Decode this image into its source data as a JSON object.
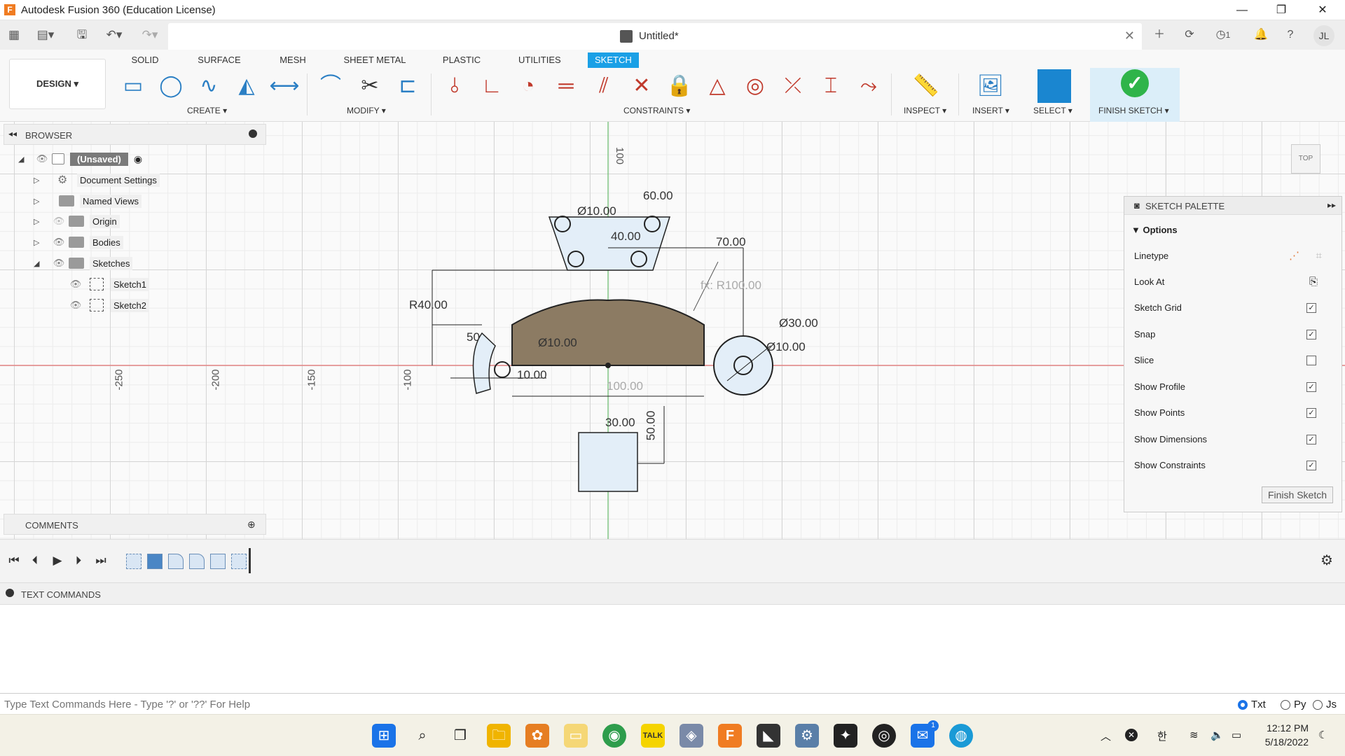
{
  "window": {
    "title": "Autodesk Fusion 360 (Education License)"
  },
  "document": {
    "name": "Untitled*",
    "notifications_count": "1",
    "user_initials": "JL"
  },
  "toolbar": {
    "tabs": [
      "SOLID",
      "SURFACE",
      "MESH",
      "SHEET METAL",
      "PLASTIC",
      "UTILITIES",
      "SKETCH"
    ],
    "active_tab": "SKETCH",
    "workspace": "DESIGN ▾",
    "groups": {
      "create": "CREATE ▾",
      "modify": "MODIFY ▾",
      "constraints": "CONSTRAINTS ▾",
      "inspect": "INSPECT ▾",
      "insert": "INSERT ▾",
      "select": "SELECT ▾",
      "finish_sketch": "FINISH SKETCH ▾"
    }
  },
  "browser": {
    "title": "BROWSER",
    "root": "(Unsaved)",
    "items": [
      "Document Settings",
      "Named Views",
      "Origin",
      "Bodies",
      "Sketches"
    ],
    "sketches": [
      "Sketch1",
      "Sketch2"
    ]
  },
  "comments": {
    "title": "COMMENTS"
  },
  "sketch": {
    "dimensions": {
      "d_top_left": "Ø10.00",
      "d_top_right": "60.00",
      "d_40": "40.00",
      "d_70": "70.00",
      "d_fx": "fx: R100.00",
      "d_r40": "R40.00",
      "d_phi10_mid": "Ø10.00",
      "d_phi30": "Ø30.00",
      "d_phi10_right": "Ø10.00",
      "d_100_h": "100.00",
      "d_30_bottom": "30.00",
      "d_50": "50.00",
      "d_50_side": "50",
      "d_10_left": "10.00"
    },
    "rulers": {
      "x": [
        "-250",
        "-200",
        "-150",
        "-100"
      ],
      "y": [
        "100"
      ]
    },
    "viewcube": "TOP"
  },
  "palette": {
    "title": "SKETCH PALETTE",
    "section": "Options",
    "options": [
      {
        "label": "Linetype",
        "kind": "icons"
      },
      {
        "label": "Look At",
        "kind": "icon"
      },
      {
        "label": "Sketch Grid",
        "checked": true
      },
      {
        "label": "Snap",
        "checked": true
      },
      {
        "label": "Slice",
        "checked": false
      },
      {
        "label": "Show Profile",
        "checked": true
      },
      {
        "label": "Show Points",
        "checked": true
      },
      {
        "label": "Show Dimensions",
        "checked": true
      },
      {
        "label": "Show Constraints",
        "checked": true
      }
    ],
    "finish_button": "Finish Sketch"
  },
  "text_commands": {
    "title": "TEXT COMMANDS",
    "placeholder": "Type Text Commands Here - Type '?' or '??' For Help",
    "modes": [
      "Txt",
      "Py",
      "Js"
    ],
    "selected_mode": "Txt"
  },
  "taskbar": {
    "time": "12:12 PM",
    "date": "5/18/2022",
    "mail_badge": "1"
  },
  "colors": {
    "accent": "#1aa0e6",
    "finish_green": "#2fb44a",
    "profile_fill": "#8c7b63",
    "sketch_line": "#222222"
  }
}
